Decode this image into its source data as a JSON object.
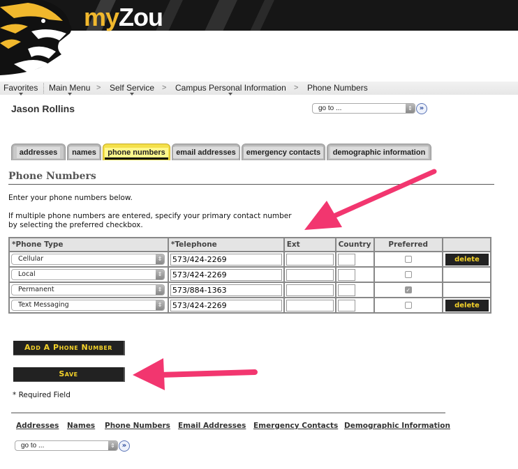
{
  "header": {
    "logo_my": "my",
    "logo_zou": "Zou",
    "mascot": "tiger-icon"
  },
  "breadcrumb": {
    "items": [
      {
        "label": "Favorites",
        "has_dropdown": true
      },
      {
        "label": "Main Menu",
        "has_dropdown": true
      },
      {
        "label": "Self Service",
        "has_dropdown": true
      },
      {
        "label": "Campus Personal Information",
        "has_dropdown": true
      },
      {
        "label": "Phone Numbers",
        "has_dropdown": false
      }
    ],
    "separator": ">"
  },
  "user": {
    "name": "Jason Rollins"
  },
  "goto": {
    "top_value": "go to ...",
    "bottom_value": "go to ...",
    "go_icon": "double-chevron-right-icon",
    "go_glyph": "»"
  },
  "tabs": [
    {
      "label": "addresses",
      "active": false
    },
    {
      "label": "names",
      "active": false
    },
    {
      "label": "phone numbers",
      "active": true
    },
    {
      "label": "email addresses",
      "active": false
    },
    {
      "label": "emergency contacts",
      "active": false
    },
    {
      "label": "demographic information",
      "active": false
    }
  ],
  "page": {
    "title": "Phone Numbers",
    "intro_1": "Enter your phone numbers below.",
    "intro_2a": "If multiple phone numbers are entered, specify your primary contact number",
    "intro_2b": "by selecting the preferred checkbox."
  },
  "table": {
    "headers": [
      "*Phone Type",
      "*Telephone",
      "Ext",
      "Country",
      "Preferred",
      ""
    ],
    "rows": [
      {
        "type": "Cellular",
        "telephone": "573/424-2269",
        "ext": "",
        "country": "",
        "preferred": false,
        "delete": "delete"
      },
      {
        "type": "Local",
        "telephone": "573/424-2269",
        "ext": "",
        "country": "",
        "preferred": false,
        "delete": null
      },
      {
        "type": "Permanent",
        "telephone": "573/884-1363",
        "ext": "",
        "country": "",
        "preferred": true,
        "delete": null
      },
      {
        "type": "Text Messaging",
        "telephone": "573/424-2269",
        "ext": "",
        "country": "",
        "preferred": false,
        "delete": "delete"
      }
    ]
  },
  "buttons": {
    "add": "Add A Phone Number",
    "save": "Save"
  },
  "required_note": "* Required Field",
  "bottom_links": [
    "Addresses",
    "Names",
    "Phone Numbers",
    "Email Addresses",
    "Emergency Contacts",
    "Demographic Information"
  ],
  "colors": {
    "brand_gold": "#f1b82d",
    "button_black": "#222222",
    "button_text": "#f4d22a",
    "active_tab": "#f4e04a",
    "annotation_arrow": "#f2366f"
  }
}
